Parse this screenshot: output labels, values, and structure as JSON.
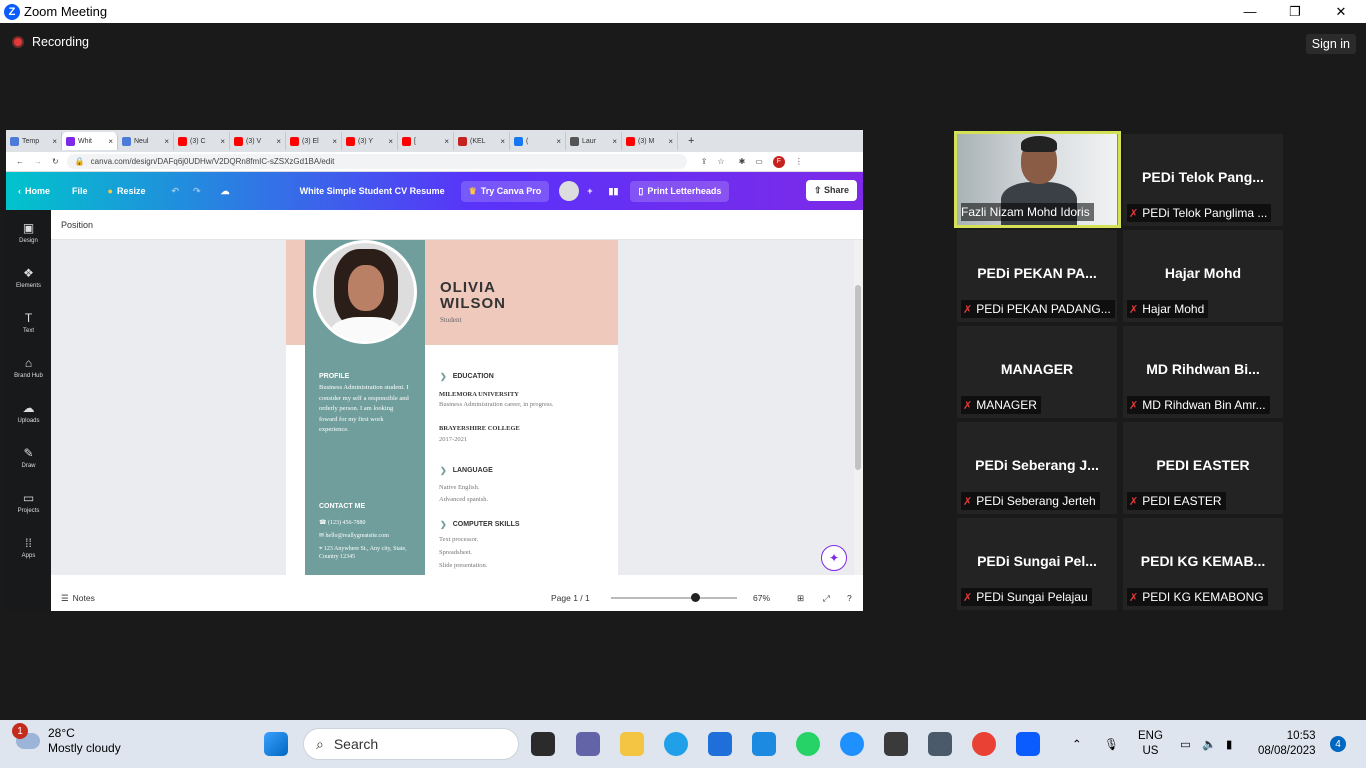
{
  "window": {
    "title": "Zoom Meeting",
    "minimize": "—",
    "maximize": "❐",
    "close": "✕"
  },
  "zoom": {
    "recording_label": "Recording",
    "signin_label": "Sign in"
  },
  "browser": {
    "tabs": [
      {
        "label": "Temp",
        "color": "#4a7bd8"
      },
      {
        "label": "Whit",
        "color": "#7d2ae8"
      },
      {
        "label": "Neul",
        "color": "#4a7bd8"
      },
      {
        "label": "(3) C",
        "color": "#ff0000"
      },
      {
        "label": "(3) V",
        "color": "#ff0000"
      },
      {
        "label": "(3) El",
        "color": "#ff0000"
      },
      {
        "label": "(3) Y",
        "color": "#ff0000"
      },
      {
        "label": "[",
        "color": "#ff0000"
      },
      {
        "label": "(KEL",
        "color": "#c5221f"
      },
      {
        "label": "(",
        "color": "#1877f2"
      },
      {
        "label": "Laur",
        "color": "#555555"
      },
      {
        "label": "(3) M",
        "color": "#ff0000"
      }
    ],
    "new_tab": "+",
    "url": "canva.com/design/DAFq6j0UDHw/V2DQRn8fmIC-sZSXzGd1BA/edit"
  },
  "canva": {
    "home": "Home",
    "file": "File",
    "resize": "Resize",
    "doc_title": "White Simple Student CV Resume",
    "try_pro": "Try Canva Pro",
    "print": "Print Letterheads",
    "share": "Share",
    "sidebar": [
      "Design",
      "Elements",
      "Text",
      "Brand Hub",
      "Uploads",
      "Draw",
      "Projects",
      "Apps"
    ],
    "position_label": "Position",
    "notes_label": "Notes",
    "page_label": "Page 1 / 1",
    "zoom_label": "67%",
    "zoom_level": 0.67
  },
  "resume": {
    "first": "OLIVIA",
    "last": "WILSON",
    "role": "Student",
    "profile_h": "PROFILE",
    "profile_t": "Business Administration student. I consider my self a responsible and orderly person. I am looking foward for my first work experience.",
    "contact_h": "CONTACT ME",
    "phone": "(123) 456-7880",
    "email": "hello@reallygreatsite.com",
    "address": "123 Anywhere St., Any city, State, Country 12345",
    "edu_h": "EDUCATION",
    "uni": "MILEMORA UNIVERSITY",
    "uni_t": "Business Administration career, in progress.",
    "college": "BRAYERSHIRE COLLEGE",
    "college_t": "2017-2021",
    "lang_h": "LANGUAGE",
    "lang_t1": "Native English.",
    "lang_t2": "Advanced spanish.",
    "skills_h": "COMPUTER SKILLS",
    "sk1": "Text processor.",
    "sk2": "Spreadsheet.",
    "sk3": "Slide presentation."
  },
  "participants": [
    {
      "big": "",
      "label": "Fazli Nizam Mohd Idoris",
      "muted": false,
      "video": true
    },
    {
      "big": "PEDi Telok Pang...",
      "label": "PEDi Telok Panglima ...",
      "muted": true
    },
    {
      "big": "PEDi PEKAN PA...",
      "label": "PEDi PEKAN PADANG...",
      "muted": true
    },
    {
      "big": "Hajar Mohd",
      "label": "Hajar Mohd",
      "muted": true
    },
    {
      "big": "MANAGER",
      "label": "MANAGER",
      "muted": true
    },
    {
      "big": "MD Rihdwan Bi...",
      "label": "MD Rihdwan Bin Amr...",
      "muted": true
    },
    {
      "big": "PEDi Seberang J...",
      "label": "PEDi Seberang Jerteh",
      "muted": true
    },
    {
      "big": "PEDI EASTER",
      "label": "PEDI EASTER",
      "muted": true
    },
    {
      "big": "PEDi Sungai Pel...",
      "label": "PEDi Sungai Pelajau",
      "muted": true
    },
    {
      "big": "PEDI KG KEMAB...",
      "label": "PEDI KG KEMABONG",
      "muted": true
    }
  ],
  "taskbar": {
    "weather_badge": "1",
    "temp": "28°C",
    "condition": "Mostly cloudy",
    "search": "Search",
    "lang1": "ENG",
    "lang2": "US",
    "time": "10:53",
    "date": "08/08/2023",
    "notif": "4"
  }
}
